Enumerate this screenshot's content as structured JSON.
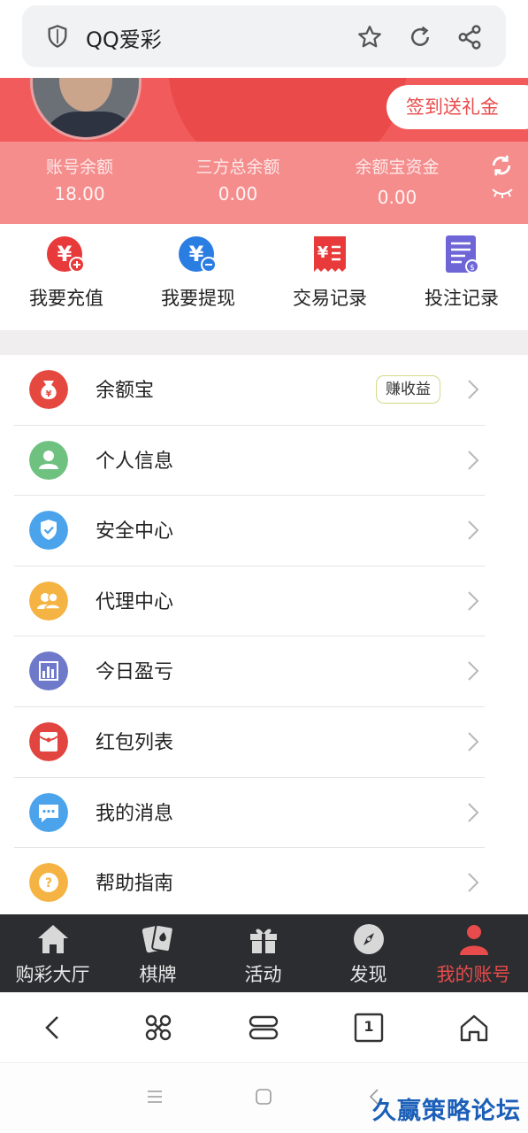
{
  "browser": {
    "title": "QQ爱彩"
  },
  "header": {
    "checkin_label": "签到送礼金"
  },
  "stats": [
    {
      "label": "账号余额",
      "value": "18.00"
    },
    {
      "label": "三方总余额",
      "value": "0.00"
    },
    {
      "label": "余额宝资金",
      "value": "0.00"
    }
  ],
  "quick_actions": [
    {
      "label": "我要充值",
      "icon": "recharge-icon",
      "color": "#e83a3a"
    },
    {
      "label": "我要提现",
      "icon": "withdraw-icon",
      "color": "#2a7de1"
    },
    {
      "label": "交易记录",
      "icon": "transaction-record-icon",
      "color": "#e83a3a"
    },
    {
      "label": "投注记录",
      "icon": "bet-record-icon",
      "color": "#6e66d6"
    }
  ],
  "menu": [
    {
      "label": "余额宝",
      "icon": "money-bag-icon",
      "color": "#e5483f",
      "badge": "赚收益"
    },
    {
      "label": "个人信息",
      "icon": "user-icon",
      "color": "#6fc180"
    },
    {
      "label": "安全中心",
      "icon": "shield-check-icon",
      "color": "#4ba3ec"
    },
    {
      "label": "代理中心",
      "icon": "agents-icon",
      "color": "#f5b343"
    },
    {
      "label": "今日盈亏",
      "icon": "bar-chart-icon",
      "color": "#6e79c9"
    },
    {
      "label": "红包列表",
      "icon": "red-envelope-icon",
      "color": "#e2453f"
    },
    {
      "label": "我的消息",
      "icon": "message-icon",
      "color": "#4ba3ec"
    },
    {
      "label": "帮助指南",
      "icon": "help-icon",
      "color": "#f5b343"
    }
  ],
  "tabs": [
    {
      "label": "购彩大厅",
      "icon": "home-icon"
    },
    {
      "label": "棋牌",
      "icon": "cards-icon"
    },
    {
      "label": "活动",
      "icon": "gift-icon"
    },
    {
      "label": "发现",
      "icon": "compass-icon"
    },
    {
      "label": "我的账号",
      "icon": "person-icon",
      "active": true
    }
  ],
  "browser_nav": {
    "tab_count": "1"
  },
  "watermark": "久赢策略论坛",
  "colors": {
    "accent": "#e84b4b",
    "header_red": "#f25b5b",
    "stats_pink": "#f58d8d",
    "tabbar_bg": "#2b2d30"
  }
}
